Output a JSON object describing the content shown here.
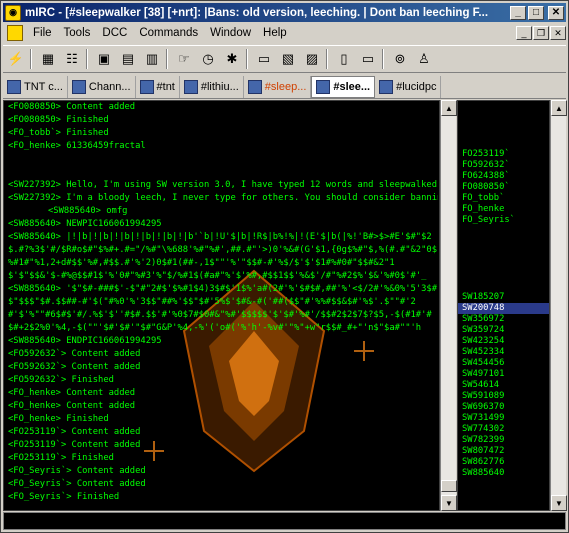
{
  "titlebar": {
    "title": "mIRC - [#sleepwalker [38] [+nrt]: |Bans: old version, leeching. | Dont ban leeching F..."
  },
  "menu": {
    "items": [
      "File",
      "Tools",
      "DCC",
      "Commands",
      "Window",
      "Help"
    ]
  },
  "toolbar": {
    "icons": [
      "connect-icon",
      "options-icon",
      "address-book-icon",
      "channels-list-icon",
      "dcc-send-icon",
      "dcc-chat-icon",
      "notify-icon",
      "timer-icon",
      "colors-icon",
      "url-list-icon",
      "received-folder-icon",
      "logs-icon",
      "tile-icon",
      "cascade-icon",
      "help-icon",
      "about-icon"
    ]
  },
  "switchbar": {
    "tabs": [
      {
        "label": "TNT c...",
        "active": false,
        "hl": false
      },
      {
        "label": "Chann...",
        "active": false,
        "hl": false
      },
      {
        "label": "#tnt",
        "active": false,
        "hl": false
      },
      {
        "label": "#lithiu...",
        "active": false,
        "hl": false
      },
      {
        "label": "#sleep...",
        "active": false,
        "hl": true
      },
      {
        "label": "#slee...",
        "active": true,
        "hl": false
      },
      {
        "label": "#lucidpc",
        "active": false,
        "hl": false
      }
    ]
  },
  "chat": {
    "lines": [
      "<FO080850> Content added",
      "<FO080850> Finished",
      "<FO_tobb`> Finished",
      "<FO_henke> 61336459fractal",
      "<SW227392> Hello, I'm using SW version 3.0, I have typed 12 words and sleepwalked 579 words.",
      "<SW227392> I'm a bloody leech, I never type for others. You should consider banning me.",
      "<SW885640> omfg",
      "<SW885640> NEWPIC166061994295",
      "<SW885640> |!|b|!|b|!|b|!|b|!|b|!|b'`b|!U'$|b|!R$|b%!%|!(E'$|b(|%!'B#>$>#E'$#\"$2$.#?%3$'#/$R#o$#\"$%#+.#=\"/%#\"\\%688'%#\"%#',##.#\"'>)0'%&#(G'$1,{0g$%#\"$,%(#.#\"&2\"0$%#1#\"%1,2+d#$$'%#,#$$.#'%'2)0$#1(##-,1$\"\"'%'\"$$#-#'%$/$'$'$1#%#0#\"$$#&2\"1$'$\"$$&'$-#%@$$#1$'%'0#\"%#3'%\"$/%#1$(#a#\"%'$'%#,#$$1$$'%&$'/#\"%#2$%'$&'%#0$'#'_$'$&\"#$#-#$'#1%&##'%&$\"%#2\"#4$#%3$\"\"'%\"'$",
      "<SW885640> '$\"$#-###$'-$\"#\"2#$'$%#1$4)3$#$'1$%'a#(2#'%'$#$#,##'%'<$/2#'%&0%'5'3$#$\"$$$\"$#.$$##-#'$(\"#%0'%'3$$\"##%'$$\"$#'5%$'$#&-#('##($$\"#'%%#$$&$#'%$'.$\"\"#'2#'$'%\"\"#6$#$'#/.%$'$''#$#.$$'#'%0$7#$0#&\"%#'$$$$$'$'$#'%#'/$$#2$2$7$?$5,-$(#1#'#$#+2$2%0'%4,-$(\"\"'$#'$#'\"$#\"G&P'%4,-%'('o#('%'h'-%v#'\"%\"+w\"r$$#_#+\"'n$\"$a#\"\"'h(a\"#\"r$r'a#\"#r'a'#",
      "<SW885640> ENDPIC166061994295",
      "<FO592632`> Content added",
      "<FO592632`> Content added",
      "<FO592632`> Finished",
      "<FO_henke> Content added",
      "<FO_henke> Content added",
      "<FO_henke> Finished",
      "<FO253119`> Content added",
      "<FO253119`> Content added",
      "<FO253119`> Finished",
      "<FO_Seyris`> Content added",
      "<FO_Seyris`> Content added",
      "<FO_Seyris`> Finished"
    ]
  },
  "nicklist": {
    "nicks": [
      "FO253119`",
      "FO592632`",
      "FO624388`",
      "FO080850`",
      "FO_tobb`",
      "FO_henke",
      "FO_Seyris`",
      "SW185207",
      "SW200748",
      "SW356972",
      "SW359724",
      "SW423254",
      "SW452334",
      "SW454456",
      "SW497101",
      "SW54614",
      "SW591089",
      "SW696370",
      "SW731499",
      "SW774302",
      "SW782399",
      "SW807472",
      "SW862776",
      "SW885640"
    ],
    "selected": "SW200748"
  },
  "editbox": {
    "value": ""
  }
}
